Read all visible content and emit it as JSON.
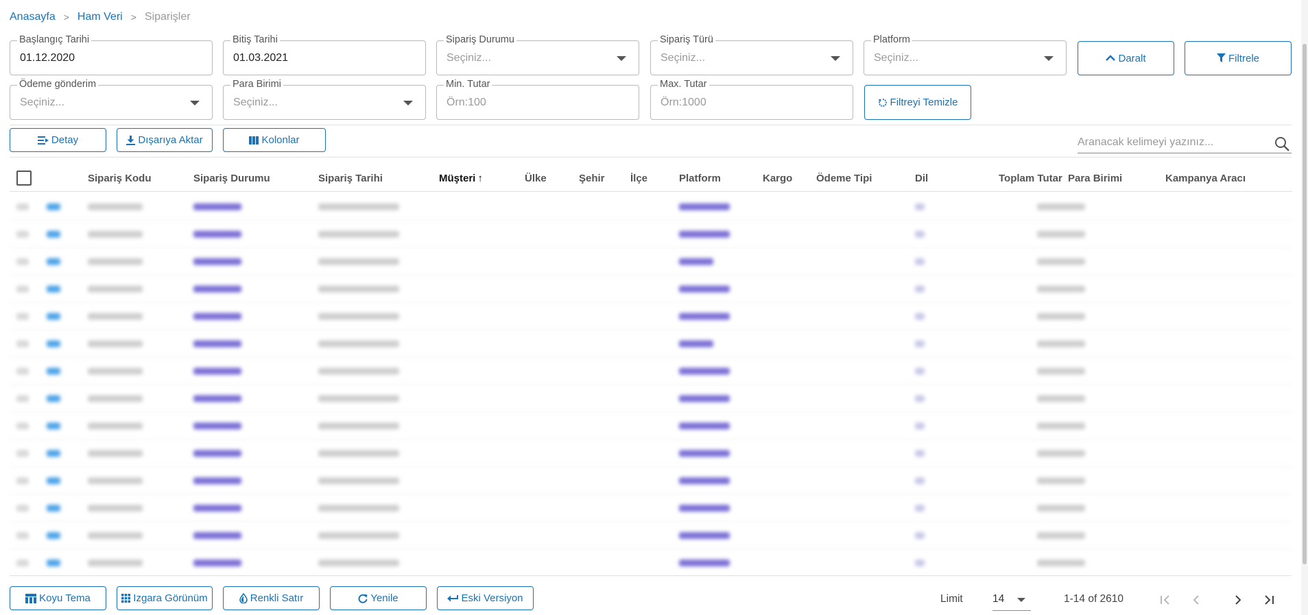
{
  "breadcrumb": {
    "home": "Anasayfa",
    "section": "Ham Veri",
    "current": "Siparişler"
  },
  "filters": {
    "start_date": {
      "label": "Başlangıç Tarihi",
      "value": "01.12.2020"
    },
    "end_date": {
      "label": "Bitiş Tarihi",
      "value": "01.03.2021"
    },
    "order_status": {
      "label": "Sipariş Durumu",
      "placeholder": "Seçiniz..."
    },
    "order_type": {
      "label": "Sipariş Türü",
      "placeholder": "Seçiniz..."
    },
    "platform": {
      "label": "Platform",
      "placeholder": "Seçiniz..."
    },
    "payment": {
      "label": "Ödeme gönderim",
      "placeholder": "Seçiniz..."
    },
    "currency": {
      "label": "Para Birimi",
      "placeholder": "Seçiniz..."
    },
    "min_amount": {
      "label": "Min. Tutar",
      "placeholder": "Örn:100"
    },
    "max_amount": {
      "label": "Max. Tutar",
      "placeholder": "Örn:1000"
    },
    "collapse_label": "Daralt",
    "filter_label": "Filtrele",
    "clear_label": "Filtreyi Temizle"
  },
  "toolbar": {
    "detail_label": "Detay",
    "export_label": "Dışarıya Aktar",
    "columns_label": "Kolonlar"
  },
  "search": {
    "placeholder": "Aranacak kelimeyi yazınız..."
  },
  "table": {
    "columns": [
      "Sipariş Kodu",
      "Sipariş Durumu",
      "Sipariş Tarihi",
      "Müşteri",
      "Ülke",
      "Şehir",
      "İlçe",
      "Platform",
      "Kargo",
      "Ödeme Tipi",
      "Dil",
      "Toplam Tutar",
      "Para Birimi",
      "Kampanya Aracı"
    ],
    "sorted_column": "Müşteri",
    "sort_direction": "ascending",
    "visible_rows": 14
  },
  "footer": {
    "dark_theme_label": "Koyu Tema",
    "grid_view_label": "Izgara Görünüm",
    "colored_row_label": "Renkli Satır",
    "refresh_label": "Yenile",
    "old_version_label": "Eski Versiyon",
    "limit_label": "Limit",
    "limit_value": "14",
    "range_text": "1-14 of 2610"
  },
  "colors": {
    "accent": "#1a73b8",
    "link_blur": "#7b6fd6",
    "icon_blur": "#4da3e8"
  },
  "icons": [
    "chevron-up-icon",
    "filter-icon",
    "reset-icon",
    "detail-icon",
    "download-icon",
    "columns-icon",
    "search-icon",
    "table-icon",
    "grid-icon",
    "drop-icon",
    "refresh-icon",
    "back-arrow-icon",
    "first-page-icon",
    "prev-page-icon",
    "next-page-icon",
    "last-page-icon"
  ]
}
